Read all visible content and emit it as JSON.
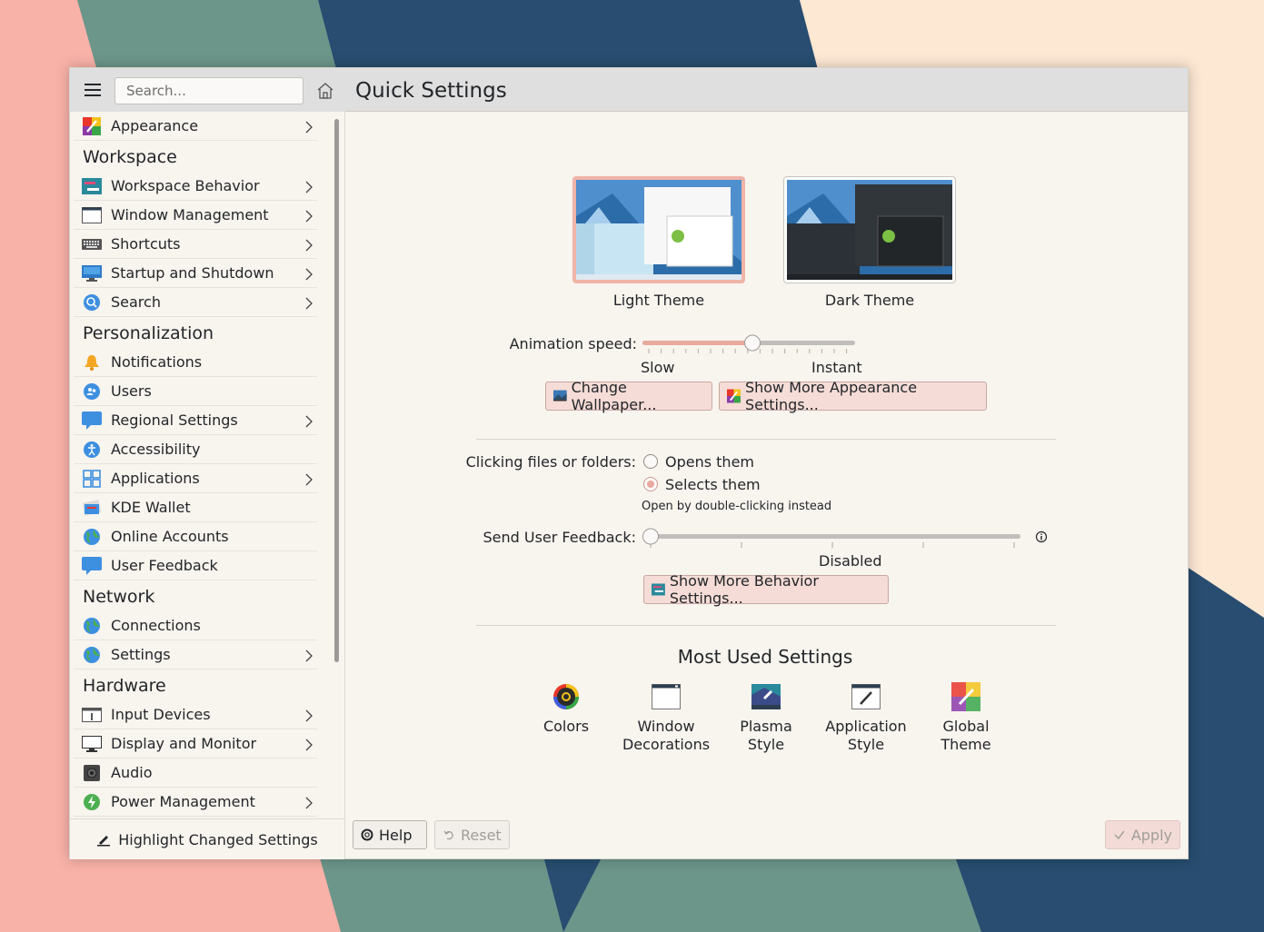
{
  "sidebar": {
    "search_placeholder": "Search...",
    "items": [
      {
        "label": "Appearance",
        "icon": "appearance-icon",
        "arrow": true
      },
      {
        "section": "Workspace"
      },
      {
        "label": "Workspace Behavior",
        "icon": "workspace-behavior-icon",
        "arrow": true
      },
      {
        "label": "Window Management",
        "icon": "window-management-icon",
        "arrow": true
      },
      {
        "label": "Shortcuts",
        "icon": "keyboard-icon",
        "arrow": true
      },
      {
        "label": "Startup and Shutdown",
        "icon": "startup-icon",
        "arrow": true
      },
      {
        "label": "Search",
        "icon": "search-icon",
        "arrow": true
      },
      {
        "section": "Personalization"
      },
      {
        "label": "Notifications",
        "icon": "bell-icon",
        "arrow": false
      },
      {
        "label": "Users",
        "icon": "users-icon",
        "arrow": false
      },
      {
        "label": "Regional Settings",
        "icon": "regional-icon",
        "arrow": true
      },
      {
        "label": "Accessibility",
        "icon": "accessibility-icon",
        "arrow": false
      },
      {
        "label": "Applications",
        "icon": "applications-icon",
        "arrow": true
      },
      {
        "label": "KDE Wallet",
        "icon": "wallet-icon",
        "arrow": false
      },
      {
        "label": "Online Accounts",
        "icon": "globe-icon",
        "arrow": false
      },
      {
        "label": "User Feedback",
        "icon": "feedback-icon",
        "arrow": false
      },
      {
        "section": "Network"
      },
      {
        "label": "Connections",
        "icon": "globe-icon",
        "arrow": false
      },
      {
        "label": "Settings",
        "icon": "globe-icon",
        "arrow": true
      },
      {
        "section": "Hardware"
      },
      {
        "label": "Input Devices",
        "icon": "input-devices-icon",
        "arrow": true
      },
      {
        "label": "Display and Monitor",
        "icon": "monitor-icon",
        "arrow": true
      },
      {
        "label": "Audio",
        "icon": "speaker-icon",
        "arrow": false
      },
      {
        "label": "Power Management",
        "icon": "power-icon",
        "arrow": true
      }
    ],
    "highlight_label": "Highlight Changed Settings"
  },
  "header": {
    "title": "Quick Settings"
  },
  "themes": {
    "light": "Light Theme",
    "dark": "Dark Theme"
  },
  "animation": {
    "label": "Animation speed:",
    "slow": "Slow",
    "instant": "Instant",
    "value": 0.5
  },
  "buttons": {
    "wallpaper": "Change Wallpaper...",
    "appearance": "Show More Appearance Settings...",
    "behavior": "Show More Behavior Settings..."
  },
  "clicking": {
    "label": "Clicking files or folders:",
    "opt1": "Opens them",
    "opt2": "Selects them",
    "hint": "Open by double-clicking instead",
    "selected": "Selects them"
  },
  "feedback": {
    "label": "Send User Feedback:",
    "state": "Disabled",
    "value": 0
  },
  "most_used": {
    "title": "Most Used Settings",
    "items": [
      {
        "label": "Colors",
        "icon": "colors-icon"
      },
      {
        "label": "Window\nDecorations",
        "icon": "window-decorations-icon"
      },
      {
        "label": "Plasma Style",
        "icon": "plasma-style-icon"
      },
      {
        "label": "Application\nStyle",
        "icon": "application-style-icon"
      },
      {
        "label": "Global\nTheme",
        "icon": "global-theme-icon"
      }
    ]
  },
  "footer": {
    "help": "Help",
    "reset": "Reset",
    "apply": "Apply"
  },
  "colors": {
    "accent": "#e8a99f",
    "window_bg": "#f8f4ee",
    "header_bg": "#dfdfdf"
  }
}
